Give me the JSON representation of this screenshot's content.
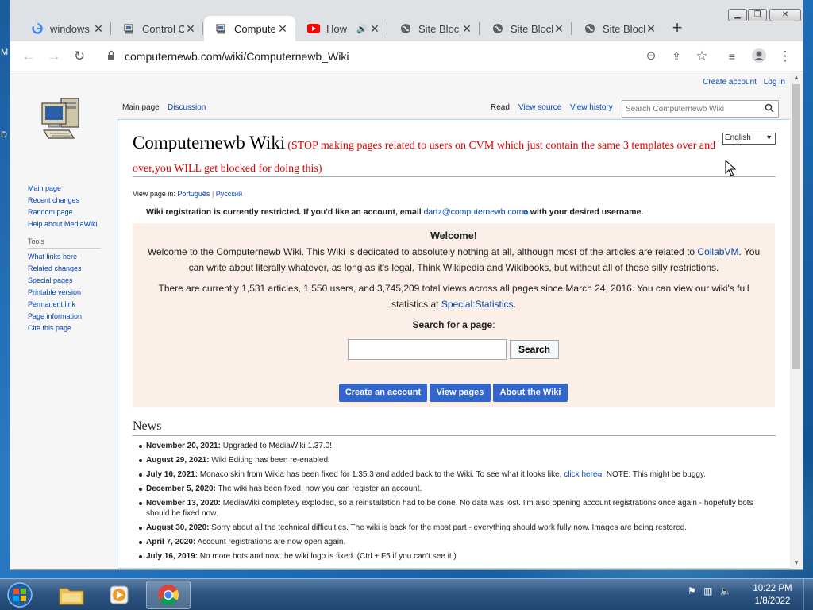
{
  "desktop": {
    "edge_chars": [
      "M",
      "D"
    ]
  },
  "browser": {
    "tabs": [
      {
        "title": "windows",
        "icon": "google-icon",
        "active": false
      },
      {
        "title": "Control C",
        "icon": "wiki-computer-icon",
        "active": false
      },
      {
        "title": "Compute",
        "icon": "wiki-computer-icon",
        "active": true
      },
      {
        "title": "How",
        "icon": "youtube-icon",
        "active": false,
        "audio": true
      },
      {
        "title": "Site Block",
        "icon": "globe-icon",
        "active": false
      },
      {
        "title": "Site Block",
        "icon": "globe-icon",
        "active": false
      },
      {
        "title": "Site Block",
        "icon": "globe-icon",
        "active": false
      }
    ],
    "url": "computernewb.com/wiki/Computernewb_Wiki"
  },
  "wiki": {
    "personal": {
      "create": "Create account",
      "login": "Log in"
    },
    "nav_tabs": {
      "main": "Main page",
      "discussion": "Discussion",
      "read": "Read",
      "view_source": "View source",
      "view_history": "View history"
    },
    "search_placeholder": "Search Computernewb Wiki",
    "sidebar": {
      "nav": [
        "Main page",
        "Recent changes",
        "Random page",
        "Help about MediaWiki"
      ],
      "tools_heading": "Tools",
      "tools": [
        "What links here",
        "Related changes",
        "Special pages",
        "Printable version",
        "Permanent link",
        "Page information",
        "Cite this page"
      ]
    },
    "title": "Computernewb Wiki",
    "title_note": "(STOP making pages related to users on CVM which just contain the same 3 templates over and over,you WILL get blocked for doing this)",
    "language": "English",
    "view_in_label": "View page in:",
    "view_in": [
      "Português",
      "Русский"
    ],
    "registration": {
      "before": "Wiki registration is currently restricted. If you'd like an account, email ",
      "email": "dartz@computernewb.com",
      "after": " with your desired username."
    },
    "welcome": {
      "title": "Welcome!",
      "p1_before": "Welcome to the Computernewb Wiki. This Wiki is dedicated to absolutely nothing at all, although most of the articles are related to ",
      "p1_link": "CollabVM",
      "p1_after": ". You can write about literally whatever, as long as it's legal. Think Wikipedia and Wikibooks, but without all of those silly restrictions.",
      "p2_before": "There are currently 1,531 articles, 1,550 users, and 3,745,209 total views across all pages since March 24, 2016. You can view our wiki's full statistics at ",
      "p2_link": "Special:Statistics",
      "p2_after": ".",
      "search_label": "Search for a page",
      "search_colon": ":",
      "search_button": "Search",
      "buttons": [
        "Create an account",
        "View pages",
        "About the Wiki"
      ]
    },
    "news_heading": "News",
    "news": [
      {
        "date": "November 20, 2021:",
        "text": " Upgraded to MediaWiki 1.37.0!"
      },
      {
        "date": "August 29, 2021:",
        "text": " Wiki Editing has been re-enabled."
      },
      {
        "date": "July 16, 2021:",
        "text": " Monaco skin from Wikia has been fixed for 1.35.3 and added back to the Wiki. To see what it looks like, ",
        "link": "click here",
        "after": ". NOTE: This might be buggy."
      },
      {
        "date": "December 5, 2020:",
        "text": " The wiki has been fixed, now you can register an account."
      },
      {
        "date": "November 13, 2020:",
        "text": " MediaWiki completely exploded, so a reinstallation had to be done. No data was lost. I'm also opening account registrations once again - hopefully bots should be fixed now."
      },
      {
        "date": "August 30, 2020:",
        "text": " Sorry about all the technical difficulties. The wiki is back for the most part - everything should work fully now. Images are being restored."
      },
      {
        "date": "April 7, 2020:",
        "text": " Account registrations are now open again."
      },
      {
        "date": "July 16, 2019:",
        "text": " No more bots and now the wiki logo is fixed. (Ctrl + F5 if you can't see it.)"
      }
    ]
  },
  "taskbar": {
    "apps": [
      "file-explorer-icon",
      "media-player-icon",
      "chrome-icon"
    ],
    "time": "10:22 PM",
    "date": "1/8/2022"
  },
  "colors": {
    "link": "#0645ad",
    "warning": "#dd0000",
    "button": "#3366cc",
    "welcome_bg": "#fbefe7"
  }
}
